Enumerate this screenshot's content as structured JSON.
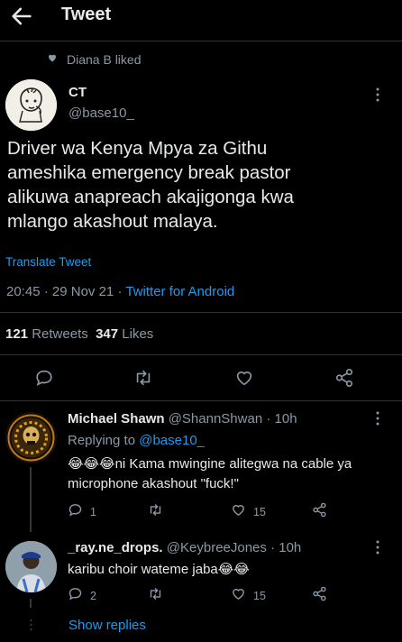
{
  "header": {
    "title": "Tweet"
  },
  "social_context": {
    "text": "Diana B liked"
  },
  "tweet": {
    "author_name": "CT",
    "author_handle": "@base10_",
    "text_lines": [
      "Driver wa Kenya Mpya za Githu",
      "ameshika emergency break pastor",
      "alikuwa anapreach akajigonga kwa",
      "mlango akashout malaya."
    ],
    "translate_label": "Translate Tweet",
    "time": "20:45",
    "date": "29 Nov 21",
    "source": "Twitter for Android",
    "retweets_count": "121",
    "retweets_label": "Retweets",
    "likes_count": "347",
    "likes_label": "Likes"
  },
  "replies": [
    {
      "name": "Michael Shawn",
      "handle": "@ShannShwan",
      "time": "10h",
      "replying_prefix": "Replying to",
      "replying_to": "@base10_",
      "emoji": "😂😂😂",
      "text_line1": "ni Kama mwingine alitegwa na cable ya",
      "text_line2": "microphone akashout \"fuck!\"",
      "reply_count": "1",
      "retweet_count": "",
      "like_count": "15"
    },
    {
      "name": "_ray.ne_drops.",
      "handle": "@KeybreeJones",
      "time": "10h",
      "text": "karibu choir wateme jaba",
      "emoji": "😂😂",
      "reply_count": "2",
      "retweet_count": "",
      "like_count": "15"
    }
  ],
  "show_replies_label": "Show replies",
  "icons": [
    "back-arrow-icon",
    "heart-icon",
    "more-icon",
    "reply-icon",
    "retweet-icon",
    "like-icon",
    "share-icon"
  ],
  "colors": {
    "background": "#000000",
    "accent": "#1d9bf0",
    "secondary_text": "#8b98a5",
    "primary_text": "#e7e9ea",
    "divider": "#2f3336"
  }
}
